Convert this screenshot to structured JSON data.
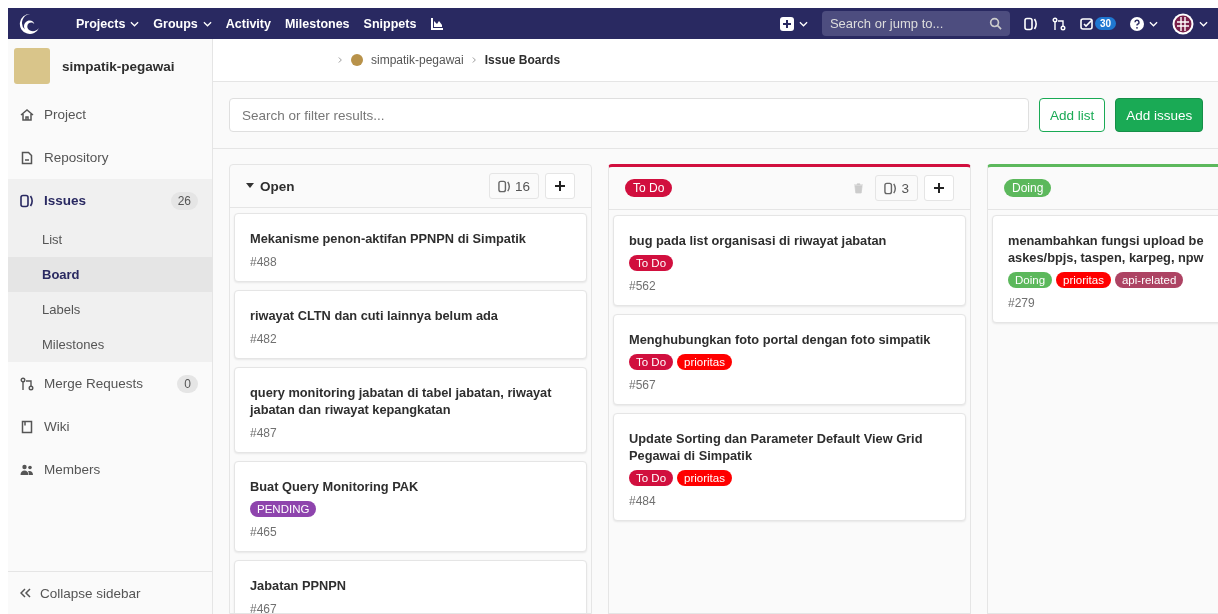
{
  "navbar": {
    "menu": [
      {
        "label": "Projects",
        "dropdown": true
      },
      {
        "label": "Groups",
        "dropdown": true
      },
      {
        "label": "Activity",
        "dropdown": false
      },
      {
        "label": "Milestones",
        "dropdown": false
      },
      {
        "label": "Snippets",
        "dropdown": false
      }
    ],
    "search": {
      "placeholder": "Search or jump to..."
    },
    "todo_count": "30"
  },
  "sidebar": {
    "project_name": "simpatik-pegawai",
    "items": [
      {
        "label": "Project",
        "selected": false
      },
      {
        "label": "Repository",
        "selected": false
      },
      {
        "label": "Issues",
        "selected": true,
        "count": "26",
        "children": [
          {
            "label": "List",
            "selected": false
          },
          {
            "label": "Board",
            "selected": true
          },
          {
            "label": "Labels",
            "selected": false
          },
          {
            "label": "Milestones",
            "selected": false
          }
        ]
      },
      {
        "label": "Merge Requests",
        "selected": false,
        "count": "0"
      },
      {
        "label": "Wiki",
        "selected": false
      },
      {
        "label": "Members",
        "selected": false
      }
    ],
    "collapse": "Collapse sidebar"
  },
  "breadcrumb": [
    "simpatik-pegawai",
    "Issue Boards"
  ],
  "filter": {
    "placeholder": "Search or filter results..."
  },
  "buttons": {
    "add_list": "Add list",
    "add_issues": "Add issues"
  },
  "lists": [
    {
      "kind": "open",
      "title": "Open",
      "count": "16",
      "deletable": false,
      "cards": [
        {
          "title": "Mekanisme penon-aktifan PPNPN di Simpatik",
          "number": "#488"
        },
        {
          "title": "riwayat CLTN dan cuti lainnya belum ada",
          "number": "#482"
        },
        {
          "title": "query monitoring jabatan di tabel jabatan, riwayat jabatan dan riwayat kepangkatan",
          "number": "#487"
        },
        {
          "title": "Buat Query Monitoring PAK",
          "labels": [
            {
              "text": "PENDING",
              "color": "#8e44ad"
            }
          ],
          "number": "#465"
        },
        {
          "title": "Jabatan PPNPN",
          "number": "#467"
        }
      ]
    },
    {
      "kind": "label",
      "title": "To Do",
      "color": "#d10f3e",
      "count": "3",
      "deletable": true,
      "cards": [
        {
          "title": "bug pada list organisasi di riwayat jabatan",
          "labels": [
            {
              "text": "To Do",
              "color": "#d10f3e"
            }
          ],
          "number": "#562"
        },
        {
          "title": "Menghubungkan foto portal dengan foto simpatik",
          "labels": [
            {
              "text": "To Do",
              "color": "#d10f3e"
            },
            {
              "text": "prioritas",
              "color": "#ff0000"
            }
          ],
          "number": "#567"
        },
        {
          "title": "Update Sorting dan Parameter Default View Grid Pegawai di Simpatik",
          "labels": [
            {
              "text": "To Do",
              "color": "#d10f3e"
            },
            {
              "text": "prioritas",
              "color": "#ff0000"
            }
          ],
          "number": "#484"
        }
      ]
    },
    {
      "kind": "label",
      "title": "Doing",
      "color": "#5cb85c",
      "cards": [
        {
          "title": "menambahkan fungsi upload be\naskes/bpjs, taspen, karpeg, npw",
          "labels": [
            {
              "text": "Doing",
              "color": "#5cb85c"
            },
            {
              "text": "prioritas",
              "color": "#ff0000"
            },
            {
              "text": "api-related",
              "color": "#ad4363"
            }
          ],
          "number": "#279"
        }
      ]
    }
  ]
}
